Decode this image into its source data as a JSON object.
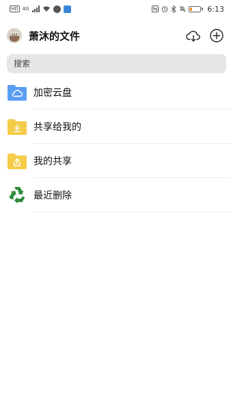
{
  "status_bar": {
    "time": "6:13",
    "left_icons": [
      "hd-icon",
      "signal-4g-icon",
      "signal-bars-icon",
      "wifi-icon",
      "app-notification-icon",
      "app-notification-icon"
    ],
    "right_icons": [
      "nfc-icon",
      "alarm-icon",
      "bluetooth-icon",
      "mute-icon",
      "battery-icon"
    ],
    "battery_level": 0.2,
    "battery_color": "#f08c1a"
  },
  "header": {
    "title": "萧沐的文件",
    "actions": [
      "cloud-download-icon",
      "add-icon"
    ]
  },
  "search": {
    "placeholder": "搜索"
  },
  "items": [
    {
      "label": "加密云盘",
      "icon": "cloud-folder-icon",
      "color": "#5b9ef5"
    },
    {
      "label": "共享给我的",
      "icon": "download-folder-icon",
      "color": "#f5cd4a"
    },
    {
      "label": "我的共享",
      "icon": "share-folder-icon",
      "color": "#f5cd4a"
    },
    {
      "label": "最近删除",
      "icon": "recycle-icon",
      "color": "#2e8b3a"
    }
  ]
}
